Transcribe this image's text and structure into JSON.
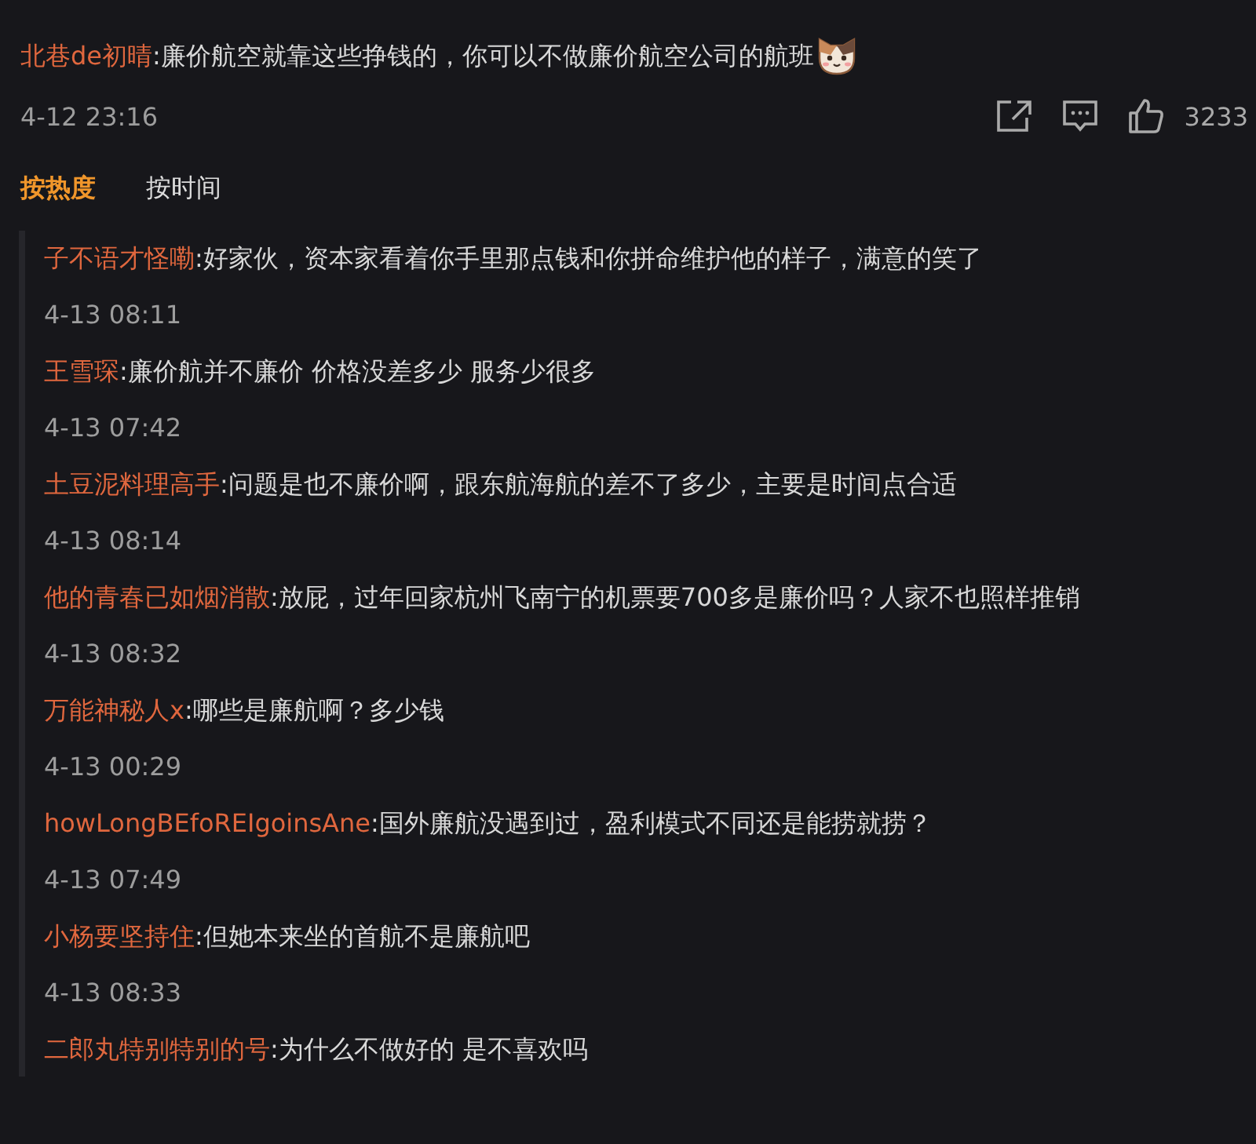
{
  "comment": {
    "user": "北巷de初晴",
    "text": ":廉价航空就靠这些挣钱的，你可以不做廉价航空公司的航班",
    "time": "4-12 23:16",
    "likes": "3233"
  },
  "sort_tabs": [
    {
      "label": "按热度",
      "selected": true
    },
    {
      "label": "按时间",
      "selected": false
    }
  ],
  "replies": [
    {
      "user": "子不语才怪嘞",
      "text": ":好家伙，资本家看着你手里那点钱和你拼命维护他的样子，满意的笑了",
      "time": "4-13 08:11"
    },
    {
      "user": "王雪琛",
      "text": ":廉价航并不廉价 价格没差多少 服务少很多",
      "time": "4-13 07:42"
    },
    {
      "user": "土豆泥料理高手",
      "text": ":问题是也不廉价啊，跟东航海航的差不了多少，主要是时间点合适",
      "time": "4-13 08:14"
    },
    {
      "user": "他的青春已如烟消散",
      "text": ":放屁，过年回家杭州飞南宁的机票要700多是廉价吗？人家不也照样推销",
      "time": "4-13 08:32"
    },
    {
      "user": "万能神秘人x",
      "text": ":哪些是廉航啊？多少钱",
      "time": "4-13 00:29"
    },
    {
      "user": "howLongBEfoREIgoinsAne",
      "text": ":国外廉航没遇到过，盈利模式不同还是能捞就捞？",
      "time": "4-13 07:49"
    },
    {
      "user": "小杨要坚持住",
      "text": ":但她本来坐的首航不是廉航吧",
      "time": "4-13 08:33"
    },
    {
      "user": "二郎丸特别特别的号",
      "text": ":为什么不做好的 是不喜欢吗"
    }
  ]
}
